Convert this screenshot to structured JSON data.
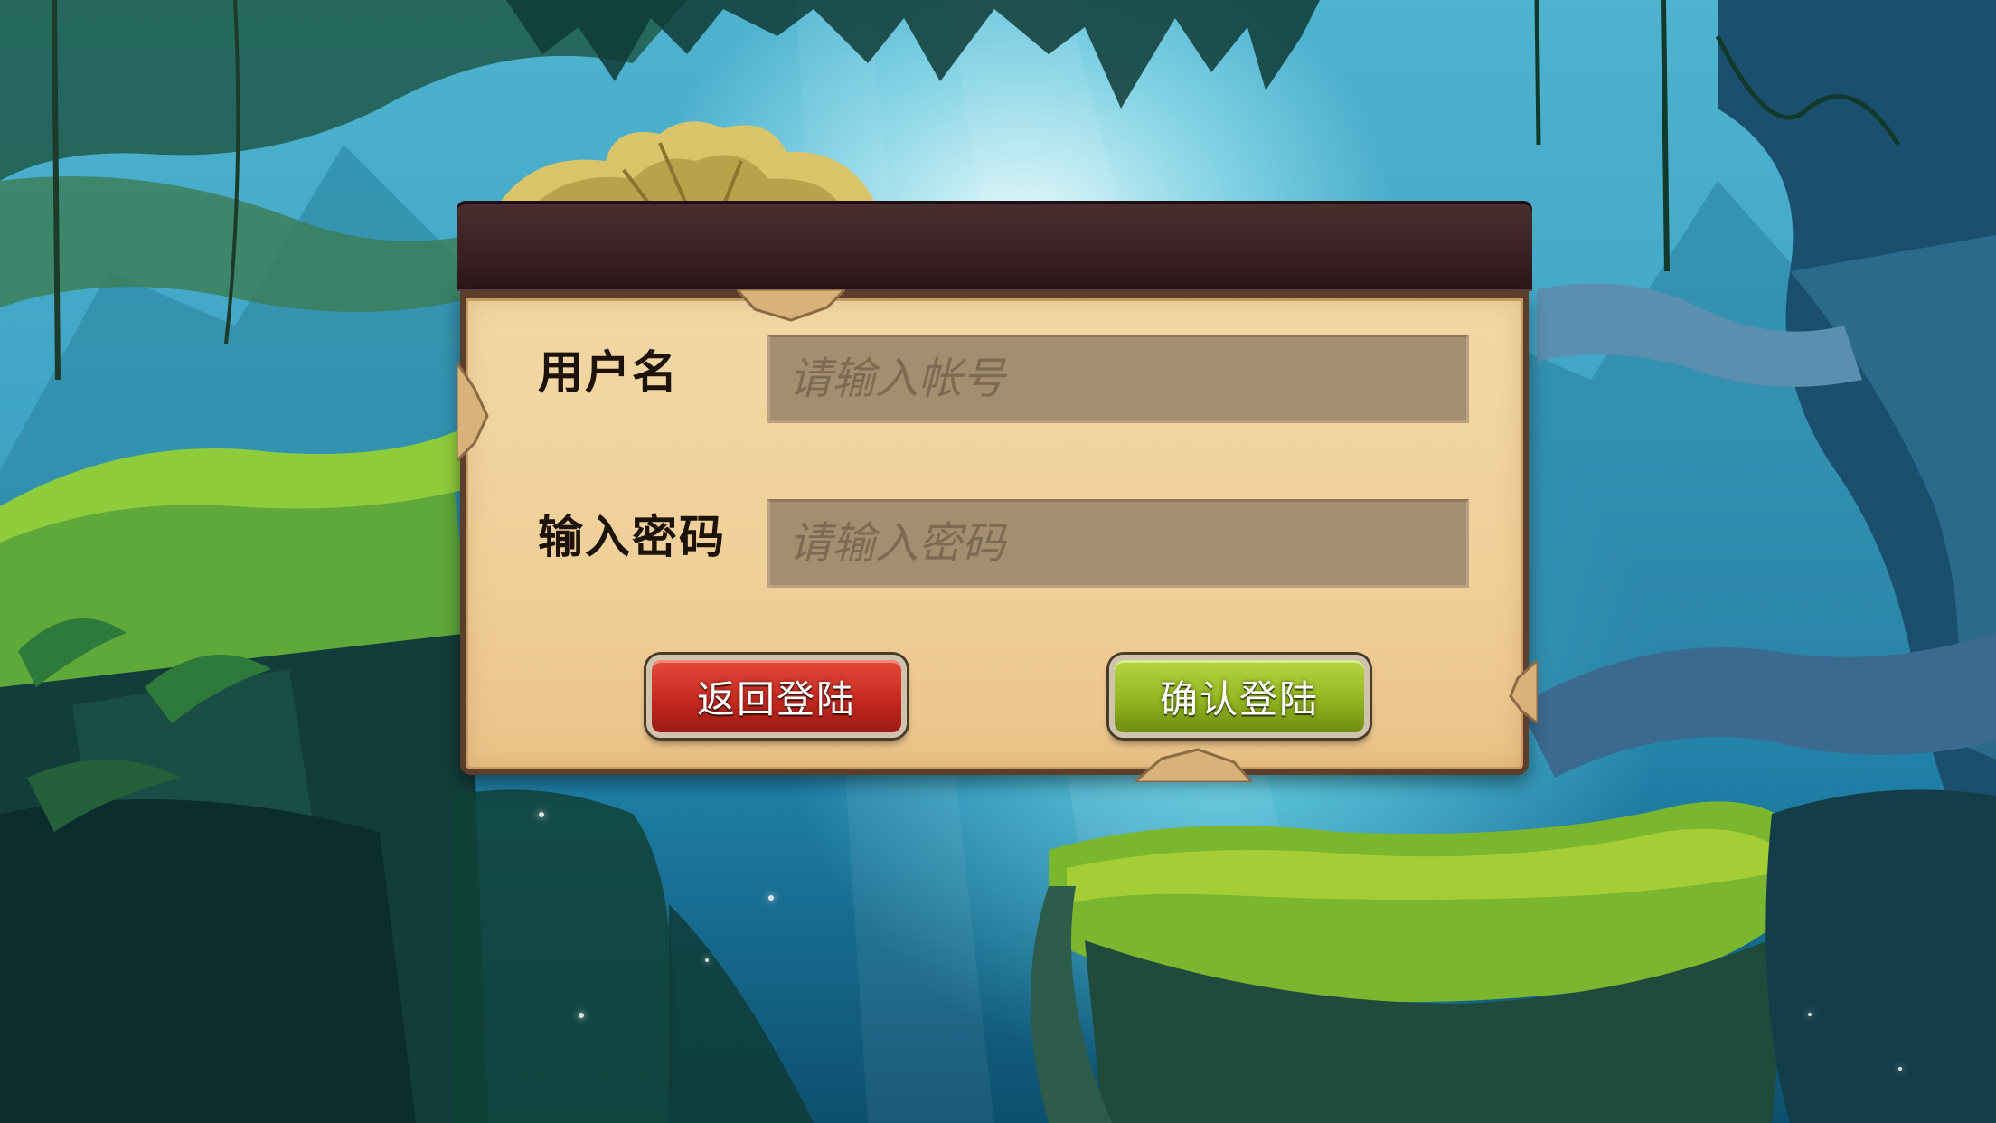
{
  "login_dialog": {
    "username_label": "用户名",
    "username_placeholder": "请输入帐号",
    "password_label": "输入密码",
    "password_placeholder": "请输入密码",
    "back_button_label": "返回登陆",
    "confirm_button_label": "确认登陆"
  },
  "colors": {
    "panel_parchment": "#f0cf98",
    "panel_header": "#3a2024",
    "input_field": "#a48e70",
    "back_button": "#c62a20",
    "confirm_button": "#93b620"
  },
  "icons": [
    "leaf-crown-icon"
  ]
}
